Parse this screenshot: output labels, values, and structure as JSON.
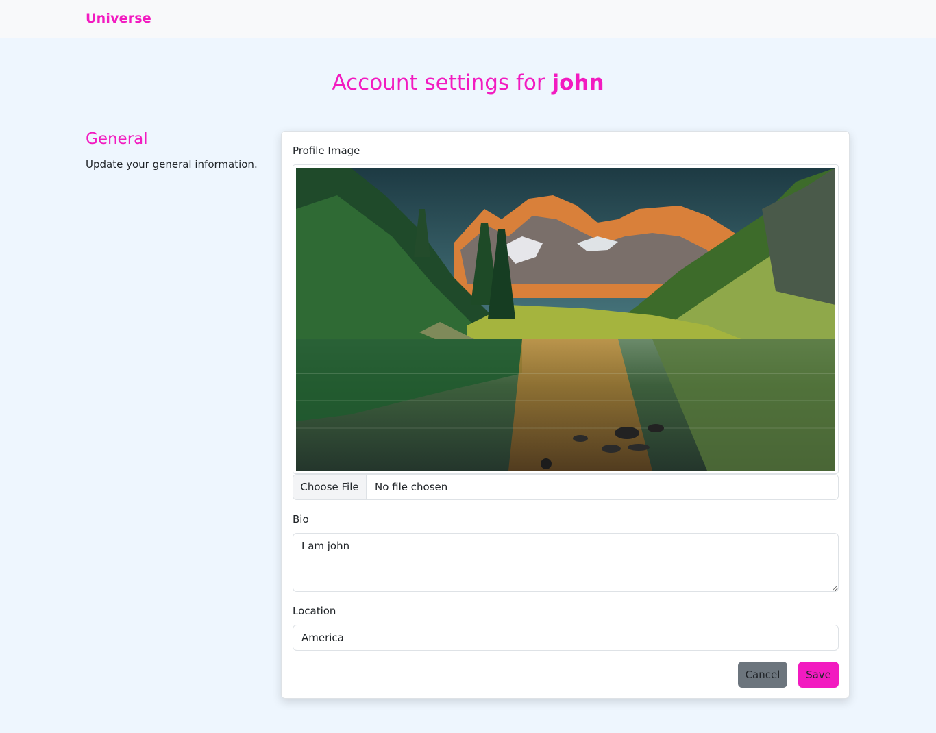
{
  "navbar": {
    "brand": "Universe"
  },
  "header": {
    "title_prefix": "Account settings for ",
    "username": "john"
  },
  "sidebar": {
    "heading": "General",
    "description": "Update your general information."
  },
  "form": {
    "profile_image_label": "Profile Image",
    "file_button_label": "Choose File",
    "file_status": "No file chosen",
    "bio_label": "Bio",
    "bio_value": "I am john",
    "location_label": "Location",
    "location_value": "America",
    "cancel_label": "Cancel",
    "save_label": "Save"
  },
  "colors": {
    "brand": "#f21bc0",
    "page_background": "#eef6fe",
    "cancel_button": "#6c757d"
  }
}
